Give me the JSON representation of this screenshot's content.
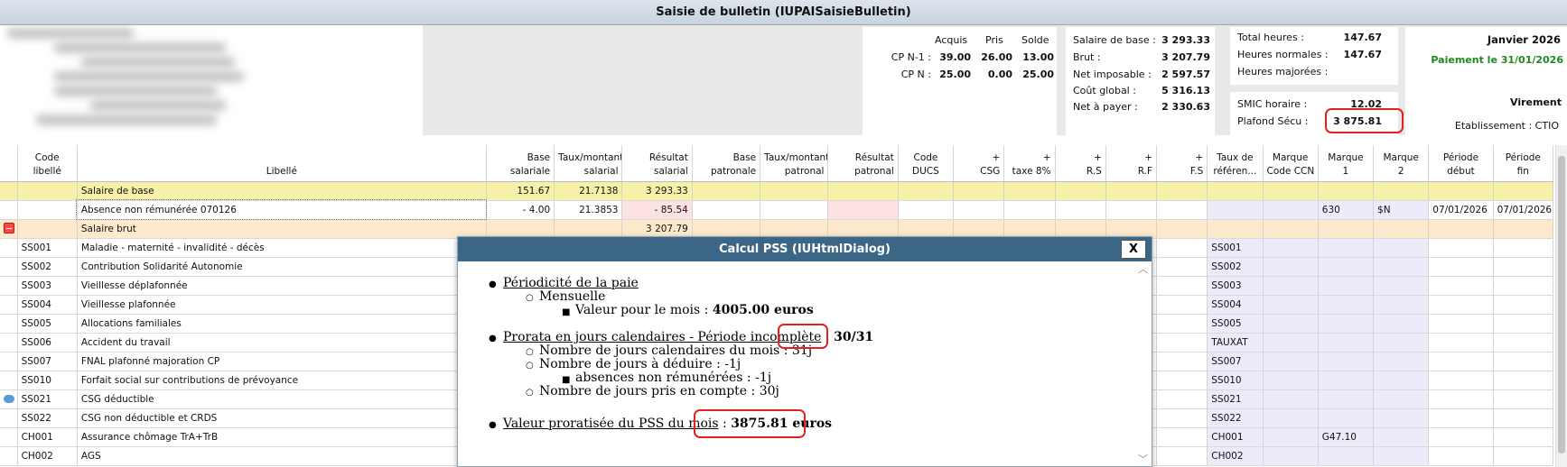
{
  "window": {
    "title": "Saisie de bulletin (IUPAISaisieBulletin)"
  },
  "cp": {
    "h_acquis": "Acquis",
    "h_pris": "Pris",
    "h_solde": "Solde",
    "rows": [
      {
        "label": "CP N-1 :",
        "acquis": "39.00",
        "pris": "26.00",
        "solde": "13.00"
      },
      {
        "label": "CP N :",
        "acquis": "25.00",
        "pris": "0.00",
        "solde": "25.00"
      }
    ]
  },
  "salary": [
    {
      "label": "Salaire de base :",
      "value": "3 293.33"
    },
    {
      "label": "Brut :",
      "value": "3 207.79"
    },
    {
      "label": "Net imposable :",
      "value": "2 597.57"
    },
    {
      "label": "Coût global :",
      "value": "5 316.13"
    },
    {
      "label": "Net à payer :",
      "value": "2 330.63"
    }
  ],
  "hours": [
    {
      "label": "Total heures :",
      "value": "147.67"
    },
    {
      "label": "Heures normales :",
      "value": "147.67"
    },
    {
      "label": "Heures majorées :",
      "value": ""
    }
  ],
  "smic": {
    "label": "SMIC horaire :",
    "value": "12.02"
  },
  "plafond": {
    "label": "Plafond Sécu :",
    "value": "3 875.81"
  },
  "period": {
    "month": "Janvier 2026",
    "payment": "Paiement le 31/01/2026",
    "mode": "Virement",
    "etab": "Etablissement : CTIO"
  },
  "columns": [
    {
      "h1": "Code",
      "h2": "libellé"
    },
    {
      "h1": "Libellé",
      "h2": ""
    },
    {
      "h1": "Base",
      "h2": "salariale"
    },
    {
      "h1": "Taux/montant",
      "h2": "salarial"
    },
    {
      "h1": "Résultat",
      "h2": "salarial"
    },
    {
      "h1": "Base",
      "h2": "patronale"
    },
    {
      "h1": "Taux/montant",
      "h2": "patronal"
    },
    {
      "h1": "Résultat",
      "h2": "patronal"
    },
    {
      "h1": "Code",
      "h2": "DUCS"
    },
    {
      "h1": "+",
      "h2": "CSG"
    },
    {
      "h1": "+",
      "h2": "taxe 8%"
    },
    {
      "h1": "+",
      "h2": "R.S"
    },
    {
      "h1": "+",
      "h2": "R.F"
    },
    {
      "h1": "+",
      "h2": "F.S"
    },
    {
      "h1": "Taux de",
      "h2": "référen..."
    },
    {
      "h1": "Marque",
      "h2": "Code CCN"
    },
    {
      "h1": "Marque",
      "h2": "1"
    },
    {
      "h1": "Marque",
      "h2": "2"
    },
    {
      "h1": "Période",
      "h2": "début"
    },
    {
      "h1": "Période",
      "h2": "fin"
    }
  ],
  "rows": [
    {
      "code": "",
      "libelle": "Salaire de base",
      "base": "151.67",
      "taux": "21.7138",
      "res": "3 293.33",
      "ref": "",
      "m1": "",
      "m2": "",
      "pd": "",
      "pf": ""
    },
    {
      "code": "",
      "libelle": "Absence non rémunérée 070126",
      "base": "- 4.00",
      "taux": "21.3853",
      "res": "- 85.54",
      "ref": "",
      "m1": "630",
      "m2": "$N",
      "pd": "07/01/2026",
      "pf": "07/01/2026"
    },
    {
      "code": "",
      "libelle": "Salaire brut",
      "base": "",
      "taux": "",
      "res": "3 207.79",
      "ref": "",
      "m1": "",
      "m2": "",
      "pd": "",
      "pf": ""
    },
    {
      "code": "SS001",
      "libelle": "Maladie - maternité - invalidité - décès",
      "base": "",
      "taux": "",
      "res": "",
      "ref": "SS001",
      "m1": "",
      "m2": "",
      "pd": "",
      "pf": ""
    },
    {
      "code": "SS002",
      "libelle": "Contribution Solidarité Autonomie",
      "base": "",
      "taux": "",
      "res": "",
      "ref": "SS002",
      "m1": "",
      "m2": "",
      "pd": "",
      "pf": ""
    },
    {
      "code": "SS003",
      "libelle": "Vieillesse déplafonnée",
      "base": "",
      "taux": "",
      "res": "",
      "ref": "SS003",
      "m1": "",
      "m2": "",
      "pd": "",
      "pf": ""
    },
    {
      "code": "SS004",
      "libelle": "Vieillesse plafonnée",
      "base": "",
      "taux": "",
      "res": "",
      "ref": "SS004",
      "m1": "",
      "m2": "",
      "pd": "",
      "pf": ""
    },
    {
      "code": "SS005",
      "libelle": "Allocations familiales",
      "base": "",
      "taux": "",
      "res": "",
      "ref": "SS005",
      "m1": "",
      "m2": "",
      "pd": "",
      "pf": ""
    },
    {
      "code": "SS006",
      "libelle": "Accident du travail",
      "base": "",
      "taux": "",
      "res": "",
      "ref": "TAUXAT",
      "m1": "",
      "m2": "",
      "pd": "",
      "pf": ""
    },
    {
      "code": "SS007",
      "libelle": "FNAL plafonné majoration CP",
      "base": "",
      "taux": "",
      "res": "",
      "ref": "SS007",
      "m1": "",
      "m2": "",
      "pd": "",
      "pf": ""
    },
    {
      "code": "SS010",
      "libelle": "Forfait social sur contributions de prévoyance",
      "base": "",
      "taux": "",
      "res": "",
      "ref": "SS010",
      "m1": "",
      "m2": "",
      "pd": "",
      "pf": ""
    },
    {
      "code": "SS021",
      "libelle": "CSG déductible",
      "base": "",
      "taux": "",
      "res": "",
      "ref": "SS021",
      "m1": "",
      "m2": "",
      "pd": "",
      "pf": ""
    },
    {
      "code": "SS022",
      "libelle": "CSG non déductible et CRDS",
      "base": "",
      "taux": "",
      "res": "",
      "ref": "SS022",
      "m1": "",
      "m2": "",
      "pd": "",
      "pf": ""
    },
    {
      "code": "CH001",
      "libelle": "Assurance chômage TrA+TrB",
      "base": "",
      "taux": "",
      "res": "",
      "ref": "CH001",
      "m1": "G47.10",
      "m2": "",
      "pd": "",
      "pf": ""
    },
    {
      "code": "CH002",
      "libelle": "AGS",
      "base": "",
      "taux": "",
      "res": "",
      "ref": "CH002",
      "m1": "",
      "m2": "",
      "pd": "",
      "pf": ""
    }
  ],
  "dialog": {
    "title": "Calcul PSS (IUHtmlDialog)",
    "close": "X",
    "s1": "Périodicité de la paie",
    "s1a": "Mensuelle",
    "s1b": "Valeur pour le mois : ",
    "s1b_val": "4005.00 euros",
    "s2": "Prorata en jours calendaires - Période incomplète",
    "s2_sep": " : ",
    "s2_val": "30/31",
    "s2a": "Nombre de jours calendaires du mois : 31j",
    "s2b": "Nombre de jours à déduire : -1j",
    "s2b1": "absences non rémunérées : -1j",
    "s2c": "Nombre de jours pris en compte : 30j",
    "s3": "Valeur proratisée du PSS du mois",
    "s3_sep": " : ",
    "s3_val": "3875.81 euros"
  }
}
